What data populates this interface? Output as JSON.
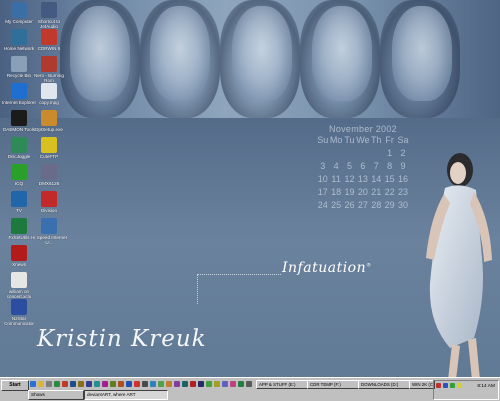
{
  "desktop_icons": [
    {
      "label": "My Computer",
      "icon": "computer-icon",
      "color": "#3a6ea5"
    },
    {
      "label": "Shortcut to JetAudio",
      "icon": "jetaudio-icon",
      "color": "#445a80"
    },
    {
      "label": "Home Network",
      "icon": "network-icon",
      "color": "#2f6f9a"
    },
    {
      "label": "CDRWIN 5",
      "icon": "cdrwin-icon",
      "color": "#c0392b"
    },
    {
      "label": "Recycle Bin",
      "icon": "recycle-bin-icon",
      "color": "#8aa0b8"
    },
    {
      "label": "Nero - Burning Rom",
      "icon": "nero-icon",
      "color": "#b03a2e"
    },
    {
      "label": "Internet Explorer",
      "icon": "ie-icon",
      "color": "#1f6fd0"
    },
    {
      "label": "copy.mpg",
      "icon": "video-file-icon",
      "color": "#dfe6ee"
    },
    {
      "label": "DAEMON Tools",
      "icon": "daemon-tools-icon",
      "color": "#1b1b1b"
    },
    {
      "label": "DptSetup.exe",
      "icon": "setup-icon",
      "color": "#c98b2b"
    },
    {
      "label": "DiscJuggle",
      "icon": "discjuggle-icon",
      "color": "#2e8b57"
    },
    {
      "label": "CuteFTP",
      "icon": "cuteftp-icon",
      "color": "#d8c020"
    },
    {
      "label": "ICQ",
      "icon": "icq-icon",
      "color": "#2aa02a"
    },
    {
      "label": "DMX6126",
      "icon": "dmx-icon",
      "color": "#6a6a8a"
    },
    {
      "label": "TV",
      "icon": "tv-icon",
      "color": "#2266aa"
    },
    {
      "label": "Division",
      "icon": "division-icon",
      "color": "#c22a2a"
    },
    {
      "label": "FxSetUtils",
      "icon": "fxsetutils-icon",
      "color": "#1e7a3c"
    },
    {
      "label": "Hi Speed Internet U...",
      "icon": "internet-icon",
      "color": "#3a70b0"
    },
    {
      "label": "Xnews",
      "icon": "xnews-icon",
      "color": "#b31b1b"
    },
    {
      "label": "william on concert.xclu",
      "icon": "media-file-icon",
      "color": "#e6e6e6"
    },
    {
      "label": "N2Star Communicator",
      "icon": "communicator-icon",
      "color": "#2b4ea0"
    }
  ],
  "calendar": {
    "title": "November 2002",
    "weekdays": [
      "Su",
      "Mo",
      "Tu",
      "We",
      "Th",
      "Fr",
      "Sa"
    ],
    "cells": [
      "",
      "",
      "",
      "",
      "",
      "1",
      "2",
      "3",
      "4",
      "5",
      "6",
      "7",
      "8",
      "9",
      "10",
      "11",
      "12",
      "13",
      "14",
      "15",
      "16",
      "17",
      "18",
      "19",
      "20",
      "21",
      "22",
      "23",
      "24",
      "25",
      "26",
      "27",
      "28",
      "29",
      "30"
    ]
  },
  "wallpaper": {
    "headline": "Infatuation",
    "registered": "®",
    "name": "Kristin Kreuk"
  },
  "taskbar": {
    "start_label": "Start",
    "tasks": [
      {
        "label": "Shows"
      },
      {
        "label": "deviantART, where ART"
      }
    ],
    "folders": [
      {
        "label": "APP & STUFF (E:)"
      },
      {
        "label": "CDR TEMP (F:)"
      },
      {
        "label": "DOWNLOADS (D:)"
      },
      {
        "label": "WIN 2K (C:)"
      }
    ],
    "clock": "8:14 AM"
  }
}
